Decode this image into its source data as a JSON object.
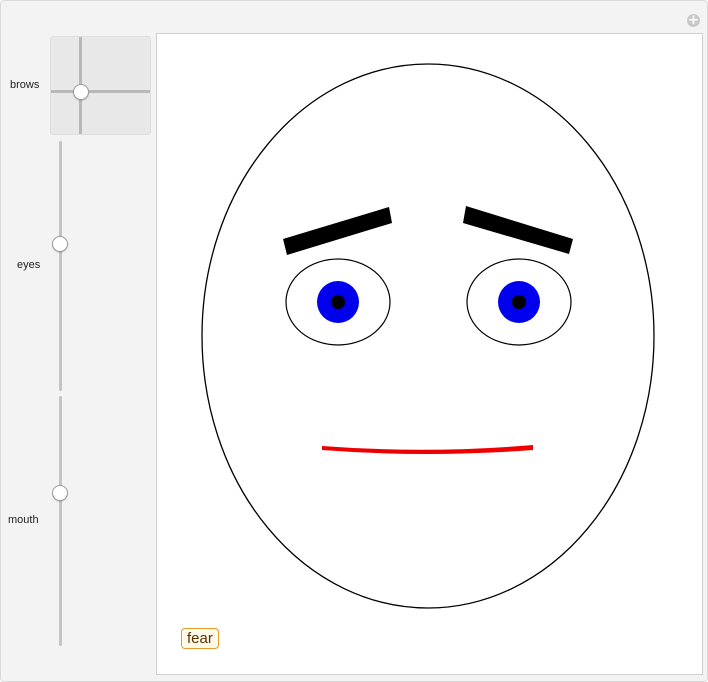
{
  "controls": {
    "brows": {
      "label": "brows",
      "x": -0.4,
      "y": -0.15
    },
    "eyes": {
      "label": "eyes",
      "value": 0.6
    },
    "mouth": {
      "label": "mouth",
      "value": 0.6
    }
  },
  "expression": {
    "label": "fear"
  },
  "colors": {
    "face_outline": "#000000",
    "iris": "#0000ee",
    "pupil": "#000000",
    "brows": "#000000",
    "mouth": "#ee0000",
    "badge_border": "#e69a2e",
    "badge_text": "#5a3200"
  },
  "icons": {
    "corner": "plus-icon"
  }
}
